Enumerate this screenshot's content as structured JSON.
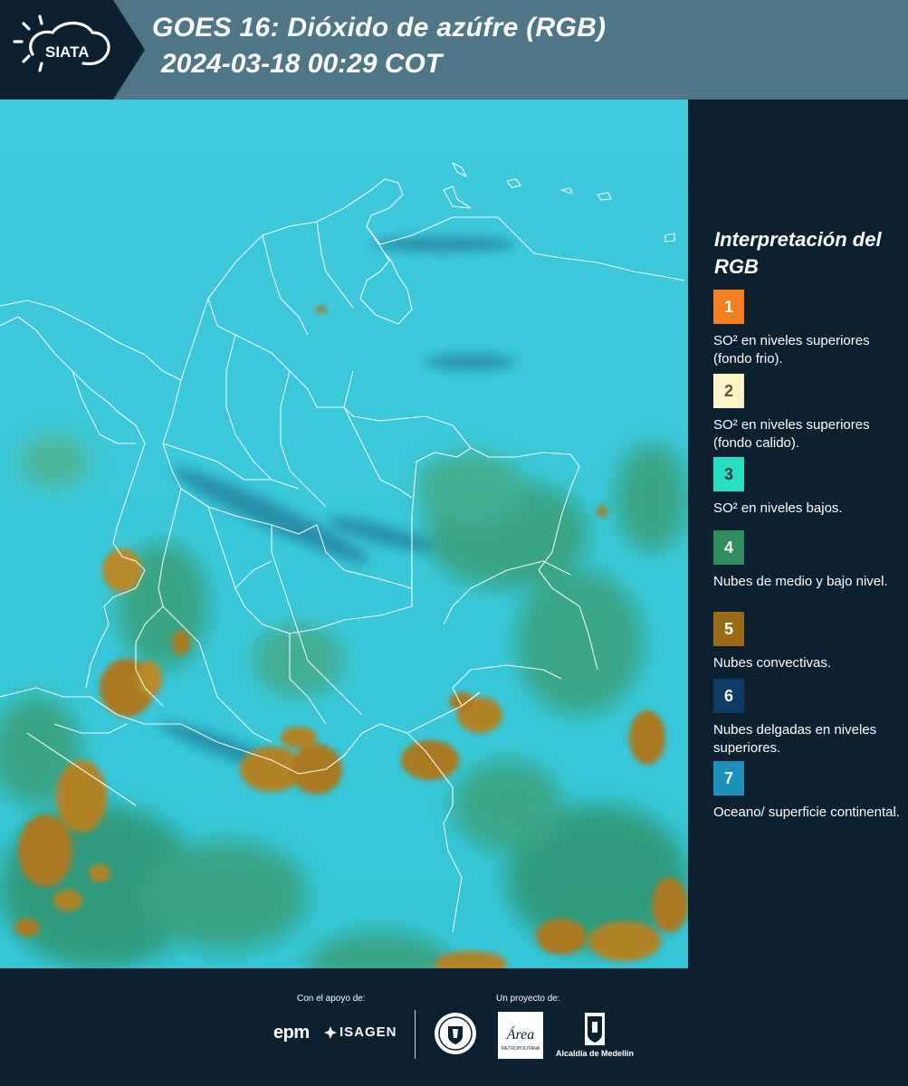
{
  "header": {
    "logo_text": "SIATA",
    "title_line1": "GOES 16: Dióxido de azúfre (RGB)",
    "title_line2": "2024-03-18 00:29 COT"
  },
  "legend": {
    "title": "Interpretación del RGB",
    "items": [
      {
        "number": "1",
        "label": "SO² en niveles superiores (fondo frio).",
        "color": "#f47f1f",
        "text_color": "#ffffff"
      },
      {
        "number": "2",
        "label": "SO² en niveles superiores (fondo calido).",
        "color": "#fdf4c4",
        "text_color": "#555555"
      },
      {
        "number": "3",
        "label": "SO² en niveles bajos.",
        "color": "#24e0c1",
        "text_color": "#333333"
      },
      {
        "number": "4",
        "label": "Nubes de medio y bajo nivel.",
        "color": "#2f8c5f",
        "text_color": "#ffffff"
      },
      {
        "number": "5",
        "label": "Nubes convectivas.",
        "color": "#9a6a17",
        "text_color": "#ffffff"
      },
      {
        "number": "6",
        "label": "Nubes delgadas en niveles superiores.",
        "color": "#0e3a66",
        "text_color": "#ffffff"
      },
      {
        "number": "7",
        "label": "Oceano/ superficie continental.",
        "color": "#1b90b8",
        "text_color": "#ffffff"
      }
    ]
  },
  "footer": {
    "support_label": "Con el apoyo de:",
    "project_label": "Un proyecto de:",
    "epm": "epm",
    "isagen": "ISAGEN",
    "amva_label": "Área",
    "amva_sub": "METROPOLITANA",
    "alcaldia": "Alcaldía de Medellín"
  }
}
